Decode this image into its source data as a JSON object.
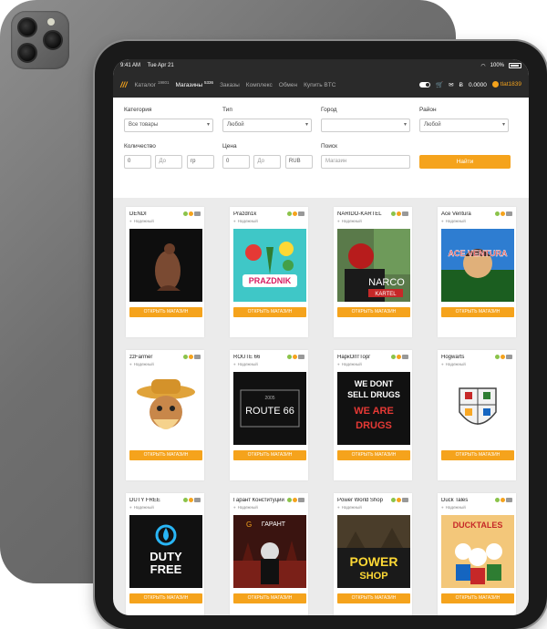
{
  "status": {
    "time": "9:41 AM",
    "date": "Tue Apr 21",
    "battery": "100%"
  },
  "nav": {
    "logo": "///",
    "items": [
      {
        "label": "Каталог",
        "count": "19801"
      },
      {
        "label": "Магазины",
        "count": "5336"
      },
      {
        "label": "Заказы",
        "count": ""
      },
      {
        "label": "Комплекс",
        "count": ""
      },
      {
        "label": "Обмен",
        "count": ""
      },
      {
        "label": "Купить BTC",
        "count": ""
      }
    ],
    "balance": "0.0000",
    "user": "tlat1839"
  },
  "filters": {
    "category_label": "Категория",
    "category_value": "Все товары",
    "type_label": "Тип",
    "type_value": "Любой",
    "city_label": "Город",
    "city_value": "",
    "district_label": "Район",
    "district_value": "Любой",
    "quantity_label": "Количество",
    "quantity_from": "0",
    "quantity_to": "До",
    "unit": "гр",
    "price_label": "Цена",
    "price_from": "0",
    "price_to": "До",
    "currency": "RUB",
    "search_label": "Поиск",
    "search_placeholder": "Магазин",
    "find_button": "Найти"
  },
  "shops": [
    {
      "name": "DENDI",
      "status": "Надежный",
      "button": "ОТКРЫТЬ МАГАЗИН",
      "thumb": "silhouette"
    },
    {
      "name": "Prazdn1k",
      "status": "Надежный",
      "button": "ОТКРЫТЬ МАГАЗИН",
      "thumb": "prazdnik",
      "thumb_text": "PRAZDNIK"
    },
    {
      "name": "NARIDO-KARTEL",
      "status": "Надежный",
      "button": "ОТКРЫТЬ МАГАЗИН",
      "thumb": "narco",
      "thumb_text": "NARCO",
      "thumb_sub": "KARTEL"
    },
    {
      "name": "Ace Ventura",
      "status": "Надежный",
      "button": "ОТКРЫТЬ МАГАЗИН",
      "thumb": "ace",
      "thumb_text": "ACE VENTURA"
    },
    {
      "name": "zzFarmer",
      "status": "Надежный",
      "button": "ОТКРЫТЬ МАГАЗИН",
      "thumb": "farmer"
    },
    {
      "name": "ROUTE 66",
      "status": "Надежный",
      "button": "ОТКРЫТЬ МАГАЗИН",
      "thumb": "route",
      "thumb_text": "ROUTE 66",
      "thumb_sub": "2005"
    },
    {
      "name": "НаркОптТорг",
      "status": "Надежный",
      "button": "ОТКРЫТЬ МАГАЗИН",
      "thumb": "drugs",
      "thumb_text": "WE DONT SELL DRUGS",
      "thumb_sub": "WE ARE DRUGS"
    },
    {
      "name": "Hogwarts",
      "status": "Надежный",
      "button": "ОТКРЫТЬ МАГАЗИН",
      "thumb": "hogwarts"
    },
    {
      "name": "DUTY FREE",
      "status": "Надежный",
      "button": "ОТКРЫТЬ МАГАЗИН",
      "thumb": "duty",
      "thumb_text": "DUTY FREE"
    },
    {
      "name": "Гарант Конституции",
      "status": "Надежный",
      "button": "ОТКРЫТЬ МАГАЗИН",
      "thumb": "garant",
      "thumb_text": "ГАРАНТ"
    },
    {
      "name": "Power World Shop",
      "status": "Надежный",
      "button": "ОТКРЫТЬ МАГАЗИН",
      "thumb": "power",
      "thumb_text": "POWER",
      "thumb_sub": "SHOP"
    },
    {
      "name": "Duck Tales",
      "status": "Надежный",
      "button": "ОТКРЫТЬ МАГАЗИН",
      "thumb": "duck",
      "thumb_text": "DUCKTALES"
    }
  ],
  "colors": {
    "accent": "#f5a31c",
    "nav_bg": "#2a2a2a",
    "page_bg": "#ebebeb"
  }
}
